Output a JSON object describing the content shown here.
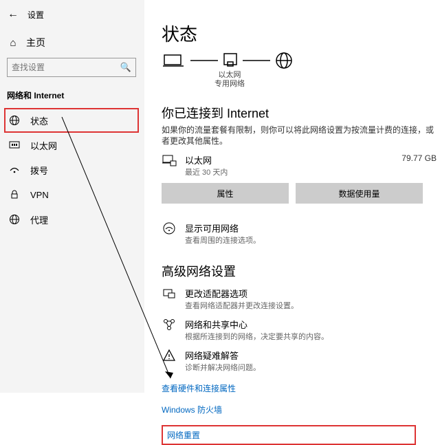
{
  "header": {
    "back": "←",
    "title": "设置"
  },
  "home": "主页",
  "search": {
    "placeholder": "查找设置"
  },
  "section": "网络和 Internet",
  "nav": {
    "status": "状态",
    "ethernet": "以太网",
    "dialup": "拨号",
    "vpn": "VPN",
    "proxy": "代理"
  },
  "main": {
    "title": "状态",
    "diagram": {
      "label1": "以太网",
      "label2": "专用网络"
    },
    "connected": {
      "title": "你已连接到 Internet",
      "desc": "如果你的流量套餐有限制，则你可以将此网络设置为按流量计费的连接，或者更改其他属性。",
      "name": "以太网",
      "sub": "最近 30 天内",
      "usage": "79.77 GB",
      "btn_props": "属性",
      "btn_usage": "数据使用量"
    },
    "shownet": {
      "t1": "显示可用网络",
      "t2": "查看周围的连接选项。"
    },
    "adv_title": "高级网络设置",
    "adapter": {
      "t1": "更改适配器选项",
      "t2": "查看网络适配器并更改连接设置。"
    },
    "sharing": {
      "t1": "网络和共享中心",
      "t2": "根据所连接到的网络，决定要共享的内容。"
    },
    "troubleshoot": {
      "t1": "网络疑难解答",
      "t2": "诊断并解决网络问题。"
    },
    "link_hw": "查看硬件和连接属性",
    "link_fw": "Windows 防火墙",
    "link_reset": "网络重置"
  }
}
